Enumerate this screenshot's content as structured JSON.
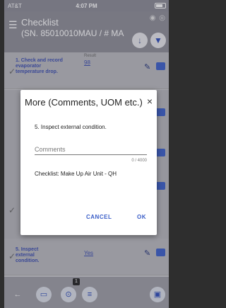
{
  "status_bar": {
    "carrier": "AT&T",
    "time": "4:07 PM"
  },
  "header": {
    "menu_icon": "hamburger-icon",
    "title_line1": "Checklist",
    "title_line2": "(SN. 85010010MAU / # MA",
    "down_icon": "↓",
    "filter_icon": "▼"
  },
  "list": {
    "items": [
      {
        "text": "1. Check and record evaporator temperature drop.",
        "result_label": "Result",
        "result_value": "98"
      },
      {
        "text": "5. Inspect external condition.",
        "result_value": "Yes"
      }
    ]
  },
  "dialog": {
    "title": "More (Comments, UOM etc.)",
    "close_icon": "×",
    "question": "5. Inspect external condition.",
    "comments_placeholder": "Comments",
    "counter": "0 / 4000",
    "checklist": "Checklist: Make Up Air Unit - QH",
    "cancel_label": "CANCEL",
    "ok_label": "OK"
  },
  "toolbar": {
    "back_icon": "←",
    "comment_icon": "▭",
    "attach_icon": "⊙",
    "list_icon": "≡",
    "save_icon": "▣",
    "badge_count": "1"
  }
}
